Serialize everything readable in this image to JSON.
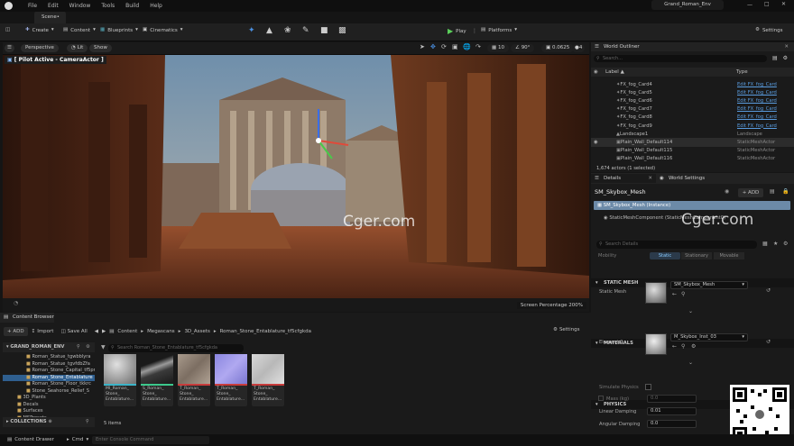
{
  "titlebar": {
    "menu": [
      "File",
      "Edit",
      "Window",
      "Tools",
      "Build",
      "Help"
    ],
    "project": "Grand_Roman_Env",
    "tab": "Scene•"
  },
  "toolbar": {
    "save_label": "",
    "create": "Create",
    "content": "Content",
    "blueprints": "Blueprints",
    "cinematics": "Cinematics",
    "play": "Play",
    "platforms": "Platforms",
    "settings": "Settings"
  },
  "viewport": {
    "perspective": "Perspective",
    "lit": "Lit",
    "show": "Show",
    "grid": "10",
    "angle": "90°",
    "scale": "0.0625",
    "cams": "4",
    "pilot": "[ Pilot Active - CameraActor ]",
    "screen_pct": "Screen Percentage  200%"
  },
  "outliner": {
    "title": "World Outliner",
    "search_placeholder": "Search...",
    "col_label": "Label ▲",
    "col_type": "Type",
    "count": "1,674 actors (1 selected)",
    "rows": [
      {
        "label": "FX_fog_Card4",
        "type": "Edit FX_fog_Card"
      },
      {
        "label": "FX_fog_Card5",
        "type": "Edit FX_fog_Card"
      },
      {
        "label": "FX_fog_Card6",
        "type": "Edit FX_fog_Card"
      },
      {
        "label": "FX_fog_Card7",
        "type": "Edit FX_fog_Card"
      },
      {
        "label": "FX_fog_Card8",
        "type": "Edit FX_fog_Card"
      },
      {
        "label": "FX_fog_Card9",
        "type": "Edit FX_fog_Card"
      },
      {
        "label": "Landscape1",
        "type": "Landscape"
      },
      {
        "label": "Plain_Wall_Default114",
        "type": "StaticMeshActor"
      },
      {
        "label": "Plain_Wall_Default115",
        "type": "StaticMeshActor"
      },
      {
        "label": "Plain_Wall_Default116",
        "type": "StaticMeshActor"
      }
    ]
  },
  "details": {
    "tab": "Details",
    "world_tab": "World Settings",
    "object": "SM_Skybox_Mesh",
    "add": "+ ADD",
    "instance": "SM_Skybox_Mesh (Instance)",
    "component": "StaticMeshComponent (StaticMeshComponent0)",
    "search_placeholder": "Search Details",
    "mobility": "Mobility",
    "mob_opts": [
      "Static",
      "Stationary",
      "Movable"
    ],
    "sec_static": "STATIC MESH",
    "static_mesh_label": "Static Mesh",
    "static_mesh_value": "SM_Skybox_Mesh",
    "sec_materials": "MATERIALS",
    "element_label": "Element 0",
    "element_value": "M_Skybox_Inst_03",
    "sec_physics": "PHYSICS",
    "sim": "Simulate Physics",
    "mass": "Mass (kg)",
    "mass_val": "0.0",
    "lin": "Linear Damping",
    "lin_val": "0.01",
    "ang": "Angular Damping",
    "ang_val": "0.0"
  },
  "content": {
    "tab": "Content Browser",
    "add": "+ ADD",
    "import": "Import",
    "save_all": "Save All",
    "settings": "Settings",
    "path": [
      "Content",
      "Megascans",
      "3D_Assets",
      "Roman_Stone_Entablature_tf5cfgkda"
    ],
    "root": "GRAND_ROMAN_ENV",
    "search_placeholder": "Search Roman_Stone_Entablature_tf5cfgkda",
    "tree": [
      "Roman_Statue_tgwbblyra",
      "Roman_Statue_tgvfdbZfa",
      "Roman_Stone_Capital_tf5pr",
      "Roman_Stone_Entablature",
      "Roman_Stone_Floor_tkkrc",
      "Stone_Seahorse_Relief_S",
      "3D_Plants",
      "Decals",
      "Surfaces",
      "MSPresets"
    ],
    "collections": "COLLECTIONS",
    "items_count": "5 items",
    "assets": [
      {
        "label": "MI_Roman_ Stone_ Entablature...",
        "bar": "#3cb4c8"
      },
      {
        "label": "S_Roman_ Stone_ Entablature...",
        "bar": "#3cc88c"
      },
      {
        "label": "T_Roman_ Stone_ Entablature...",
        "bar": "#c83c3c"
      },
      {
        "label": "T_Roman_ Stone_ Entablature...",
        "bar": "#c83c3c"
      },
      {
        "label": "T_Roman_ Stone_ Entablature...",
        "bar": "#c83c3c"
      }
    ]
  },
  "statusbar": {
    "drawer": "Content Drawer",
    "cmd": "Cmd",
    "console_placeholder": "Enter Console Command"
  },
  "watermark": "Cger.com"
}
